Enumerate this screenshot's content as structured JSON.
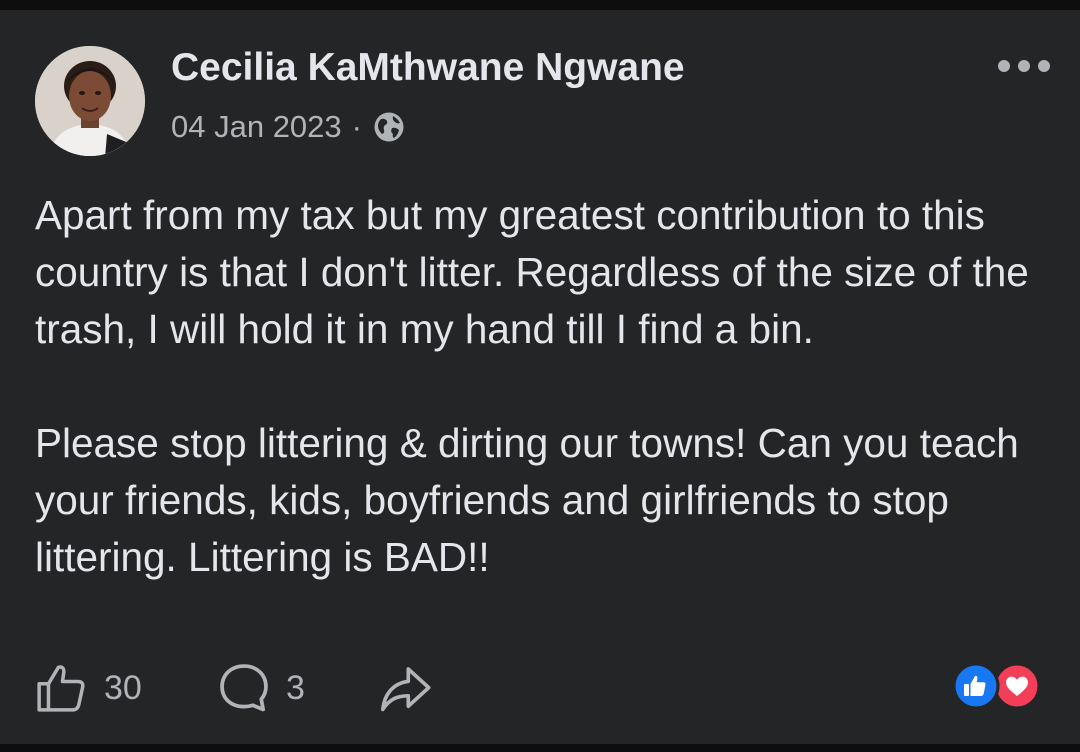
{
  "post": {
    "author": "Cecilia KaMthwane Ngwane",
    "date": "04 Jan 2023",
    "separator": "·",
    "audience_icon": "globe-icon",
    "text": "Apart from my tax but my greatest contribution to this country is that I don't litter. Regardless of the size of the trash, I will hold it in my hand till I find a bin.\n\nPlease stop littering & dirting our towns! Can you teach your friends, kids, boyfriends and girlfriends to stop littering. Littering is BAD!!"
  },
  "actions": {
    "like_icon": "thumbs-up-icon",
    "like_count": "30",
    "comment_icon": "comment-bubble-icon",
    "comment_count": "3",
    "share_icon": "share-arrow-icon"
  },
  "reactions": {
    "types": [
      "like",
      "love"
    ],
    "like_color": "#1877f2",
    "love_color": "#f33e58"
  },
  "colors": {
    "background": "#242526",
    "text_primary": "#e4e6eb",
    "text_secondary": "#b0b3b8"
  }
}
